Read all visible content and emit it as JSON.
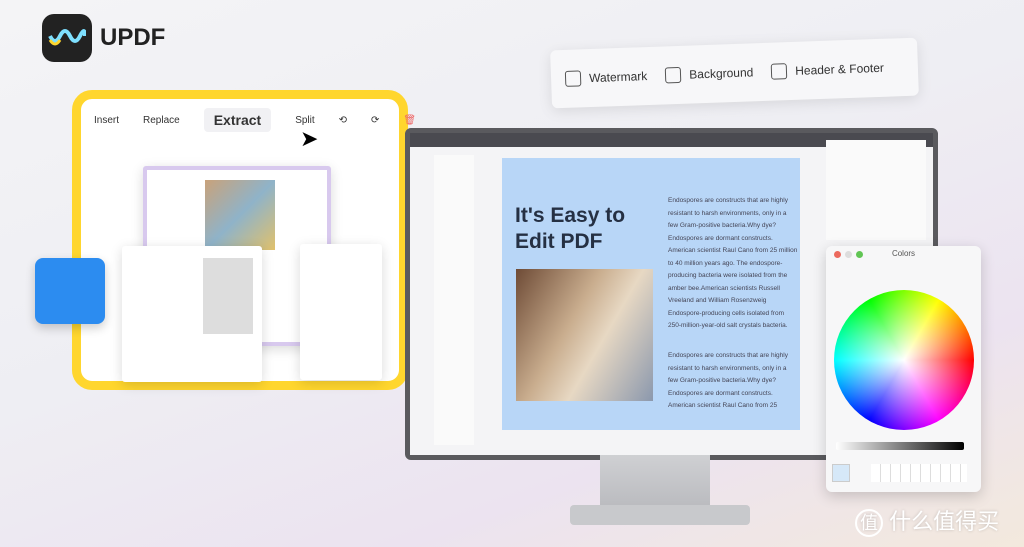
{
  "brand": {
    "name": "UPDF"
  },
  "toolbar_top": {
    "items": [
      "Watermark",
      "Background",
      "Header & Footer"
    ]
  },
  "page_tools": {
    "insert": "Insert",
    "replace": "Replace",
    "extract": "Extract",
    "split": "Split"
  },
  "doc": {
    "title_line1": "It's Easy to",
    "title_line2": "Edit PDF",
    "para1": "Endospores are constructs that are highly resistant to harsh environments, only in a few Gram-positive bacteria.Why dye? Endospores are dormant constructs. American scientist Raul Cano from 25 million to 40 million years ago. The endospore-producing bacteria were isolated from the amber bee.American scientists Russell Vreeland and William Rosenzweig Endospore-producing cells isolated from 250-million-year-old salt crystals bacteria.",
    "para2": "Endospores are constructs that are highly resistant to harsh environments, only in a few Gram-positive bacteria.Why dye? Endospores are dormant constructs. American scientist Raul Cano from 25"
  },
  "colors_panel": {
    "title": "Colors"
  },
  "watermark": {
    "text": "什么值得买",
    "badge": "值"
  }
}
